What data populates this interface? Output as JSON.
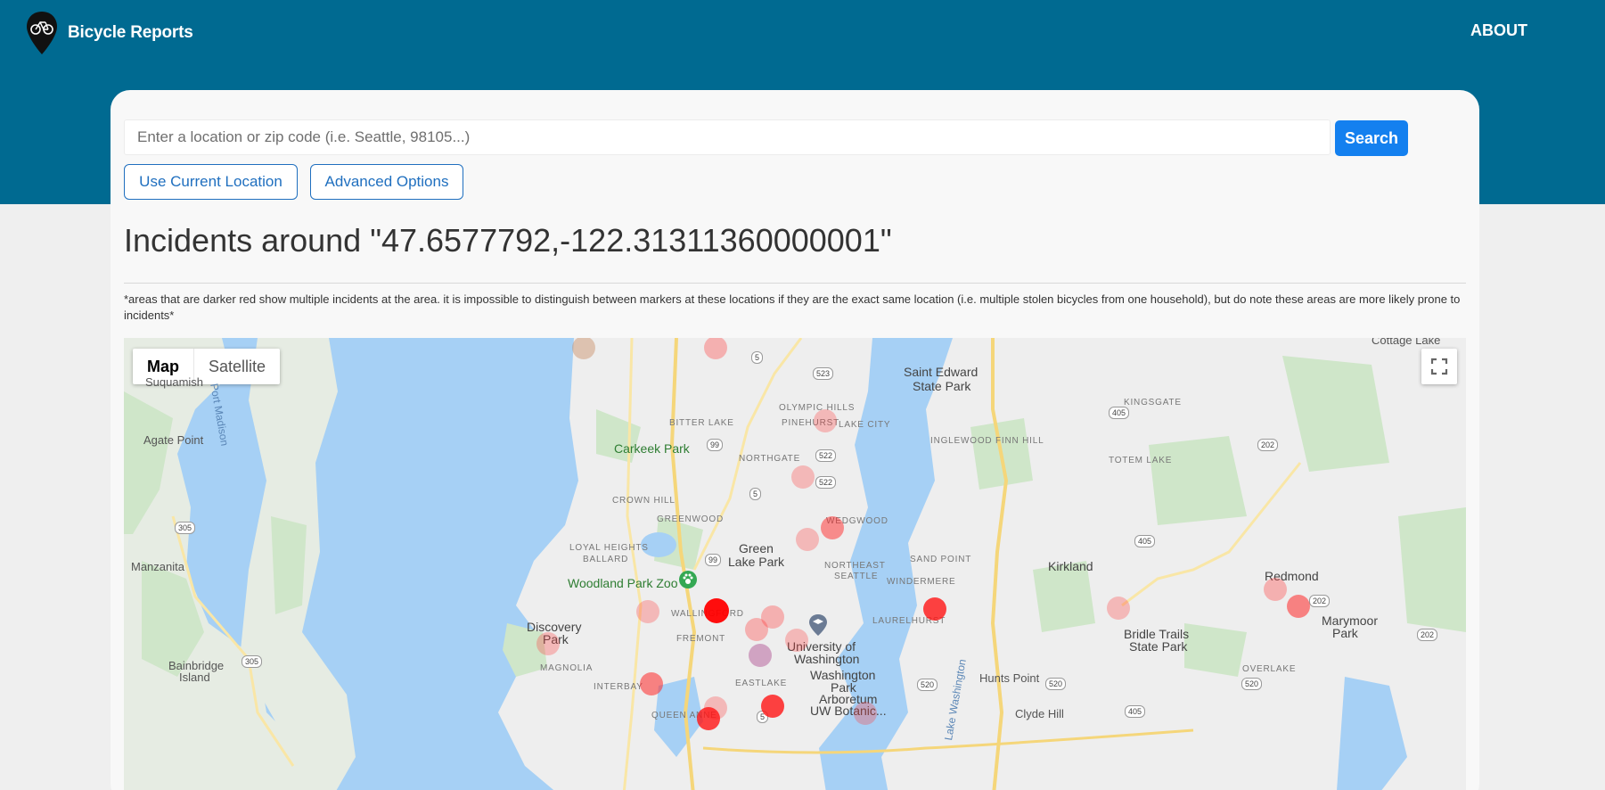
{
  "header": {
    "brand": "Bicycle Reports",
    "about": "ABOUT"
  },
  "search": {
    "placeholder": "Enter a location or zip code (i.e. Seattle, 98105...)",
    "value": "",
    "button": "Search",
    "current_location": "Use Current Location",
    "advanced_options": "Advanced Options"
  },
  "results": {
    "heading": "Incidents around \"47.6577792,-122.31311360000001\"",
    "note": "*areas that are darker red show multiple incidents at the area. it is impossible to distinguish between markers at these locations if they are the exact same location (i.e. multiple stolen bicycles from one household), but do note these areas are more likely prone to incidents*"
  },
  "map": {
    "type_map": "Map",
    "type_satellite": "Satellite",
    "labels": {
      "cottage_lake": "Cottage Lake",
      "suquamish": "Suquamish",
      "port_madison": "Port Madison",
      "saint_edward": "Saint Edward",
      "state_park": "State Park",
      "olympic_hills": "OLYMPIC HILLS",
      "kingsgate": "KINGSGATE",
      "agate_point": "Agate Point",
      "bitter_lake": "BITTER LAKE",
      "pinehurst": "PINEHURST",
      "lake_city": "LAKE CITY",
      "inglewood": "INGLEWOOD FINN HILL",
      "carkeek_park": "Carkeek Park",
      "northgate": "NORTHGATE",
      "totem_lake": "TOTEM LAKE",
      "crown_hill": "CROWN HILL",
      "wedgwood": "WEDGWOOD",
      "greenwood": "GREENWOOD",
      "manzanita": "Manzanita",
      "loyal_heights": "LOYAL HEIGHTS",
      "ballard": "BALLARD",
      "green_lake": "Green",
      "green_lake_2": "Lake Park",
      "northeast_seattle": "NORTHEAST",
      "northeast_seattle_2": "SEATTLE",
      "sand_point": "SAND POINT",
      "kirkland": "Kirkland",
      "redmond": "Redmond",
      "woodland_park_zoo": "Woodland Park Zoo",
      "windermere": "WINDERMERE",
      "wallingford": "WALLINGFORD",
      "discovery_park": "Discovery",
      "discovery_park_2": "Park",
      "laurelhurst": "LAURELHURST",
      "fremont": "FREMONT",
      "university": "University of",
      "university_2": "Washington",
      "bridle_trails": "Bridle Trails",
      "bridle_trails_2": "State Park",
      "marymoor": "Marymoor",
      "marymoor_2": "Park",
      "magnolia": "MAGNOLIA",
      "bainbridge": "Bainbridge",
      "bainbridge_2": "Island",
      "washington_park": "Washington",
      "washington_park_2": "Park",
      "washington_park_3": "Arboretum",
      "washington_park_4": "UW Botanic...",
      "hunts_point": "Hunts Point",
      "overlake": "OVERLAKE",
      "interbay": "INTERBAY",
      "eastlake": "EASTLAKE",
      "queen_anne": "QUEEN ANNE",
      "clyde_hill": "Clyde Hill",
      "lake_washington": "Lake Washington"
    },
    "shields": [
      "5",
      "523",
      "405",
      "99",
      "522",
      "5",
      "202",
      "305",
      "99",
      "520",
      "520",
      "520",
      "202",
      "202",
      "305",
      "405",
      "5",
      "405",
      "522"
    ]
  },
  "colors": {
    "header_bg": "#006a91",
    "primary": "#1480ef",
    "marker": "#ff0000"
  }
}
